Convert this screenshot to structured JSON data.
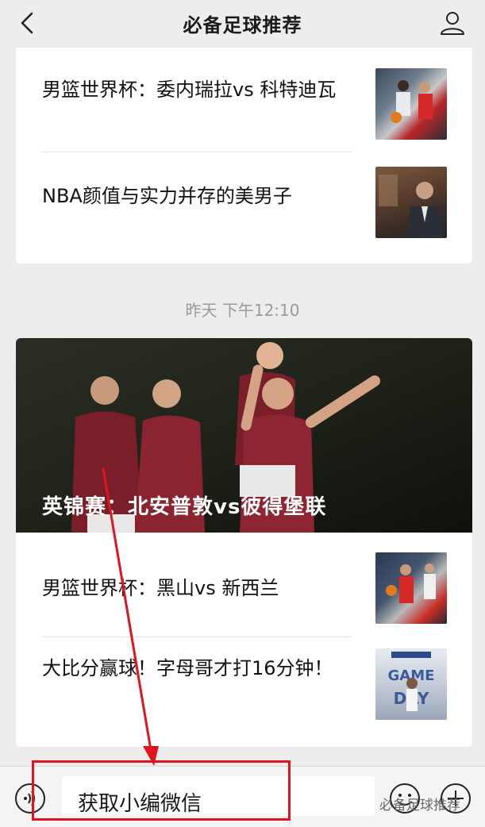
{
  "header": {
    "title": "必备足球推荐"
  },
  "card1": {
    "items": [
      {
        "title": "男篮世界杯：委内瑞拉vs 科特迪瓦",
        "thumb_icon": "basketball-players-photo"
      },
      {
        "title": "NBA颜值与实力并存的美男子",
        "thumb_icon": "man-in-suit-photo"
      }
    ]
  },
  "timestamp": "昨天 下午12:10",
  "card2": {
    "hero": {
      "caption": "英锦赛：北安普敦vs彼得堡联",
      "image_icon": "football-players-celebrating-photo"
    },
    "items": [
      {
        "title": "男篮世界杯：黑山vs 新西兰",
        "thumb_icon": "basketball-game-photo"
      },
      {
        "title": "大比分赢球！字母哥才打16分钟！",
        "thumb_icon": "game-day-poster"
      }
    ]
  },
  "bottom_bar": {
    "menu_label": "获取小编微信",
    "watermark": "必备足球推荐"
  },
  "colors": {
    "annotation_red": "#e0141e",
    "background": "#ededed"
  }
}
